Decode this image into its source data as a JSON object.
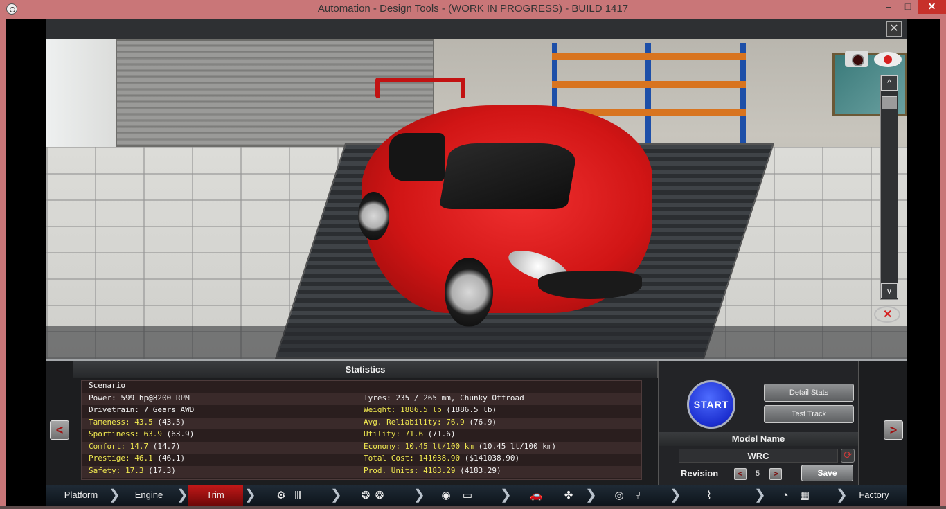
{
  "window": {
    "title": "Automation - Design Tools - (WORK IN PROGRESS) - BUILD 1417",
    "min": "–",
    "max": "□",
    "close": "✕"
  },
  "viewport": {
    "close": "✕",
    "up": "^",
    "down": "v",
    "icons": [
      "camera-icon",
      "eye-icon",
      "hide-view-icon"
    ]
  },
  "statistics": {
    "title": "Statistics",
    "left": [
      {
        "label": "Scenario",
        "paren": "",
        "highlight": false
      },
      {
        "label": "Power: 599 hp@8200 RPM",
        "paren": "",
        "highlight": false
      },
      {
        "label": "Drivetrain: 7 Gears AWD",
        "paren": "",
        "highlight": false
      },
      {
        "label": "Tameness: 43.5",
        "paren": " (43.5)",
        "highlight": true
      },
      {
        "label": "Sportiness: 63.9",
        "paren": " (63.9)",
        "highlight": true
      },
      {
        "label": "Comfort: 14.7",
        "paren": " (14.7)",
        "highlight": true
      },
      {
        "label": "Prestige: 46.1",
        "paren": " (46.1)",
        "highlight": true
      },
      {
        "label": "Safety: 17.3",
        "paren": " (17.3)",
        "highlight": true
      }
    ],
    "right": [
      {
        "label": "",
        "paren": "",
        "highlight": false
      },
      {
        "label": "Tyres: 235 / 265 mm, Chunky Offroad",
        "paren": "",
        "highlight": false
      },
      {
        "label": "Weight: 1886.5 lb",
        "paren": " (1886.5 lb)",
        "highlight": true
      },
      {
        "label": "Avg. Reliability: 76.9",
        "paren": " (76.9)",
        "highlight": true
      },
      {
        "label": "Utility: 71.6",
        "paren": " (71.6)",
        "highlight": true
      },
      {
        "label": "Economy: 10.45 lt/100 km",
        "paren": " (10.45 lt/100 km)",
        "highlight": true
      },
      {
        "label": "Total Cost: 141038.90",
        "paren": " ($141038.90)",
        "highlight": true
      },
      {
        "label": "Prod. Units: 4183.29",
        "paren": " (4183.29)",
        "highlight": true
      }
    ]
  },
  "controls": {
    "prev": "<",
    "next": ">",
    "start": "START",
    "detail_stats": "Detail Stats",
    "test_track": "Test Track",
    "model_name_label": "Model Name",
    "model_name_value": "WRC",
    "revision_label": "Revision",
    "revision_value": "5",
    "rev_dec": "<",
    "rev_inc": ">",
    "save": "Save"
  },
  "nav": {
    "platform": "Platform",
    "engine": "Engine",
    "trim": "Trim",
    "factory": "Factory",
    "sep": "❯",
    "icons": [
      "gearbox-icon",
      "wheels-icon",
      "brakes-icon",
      "body-icon",
      "fan-icon",
      "steering-icon",
      "seat-icon",
      "suspension-icon",
      "gauge-icon",
      "checkered-flag-icon"
    ]
  },
  "colors": {
    "titlebar": "#c97678",
    "highlight_text": "#f0e850",
    "active_tab": "#c01818",
    "start_button": "#1c2fd0"
  }
}
